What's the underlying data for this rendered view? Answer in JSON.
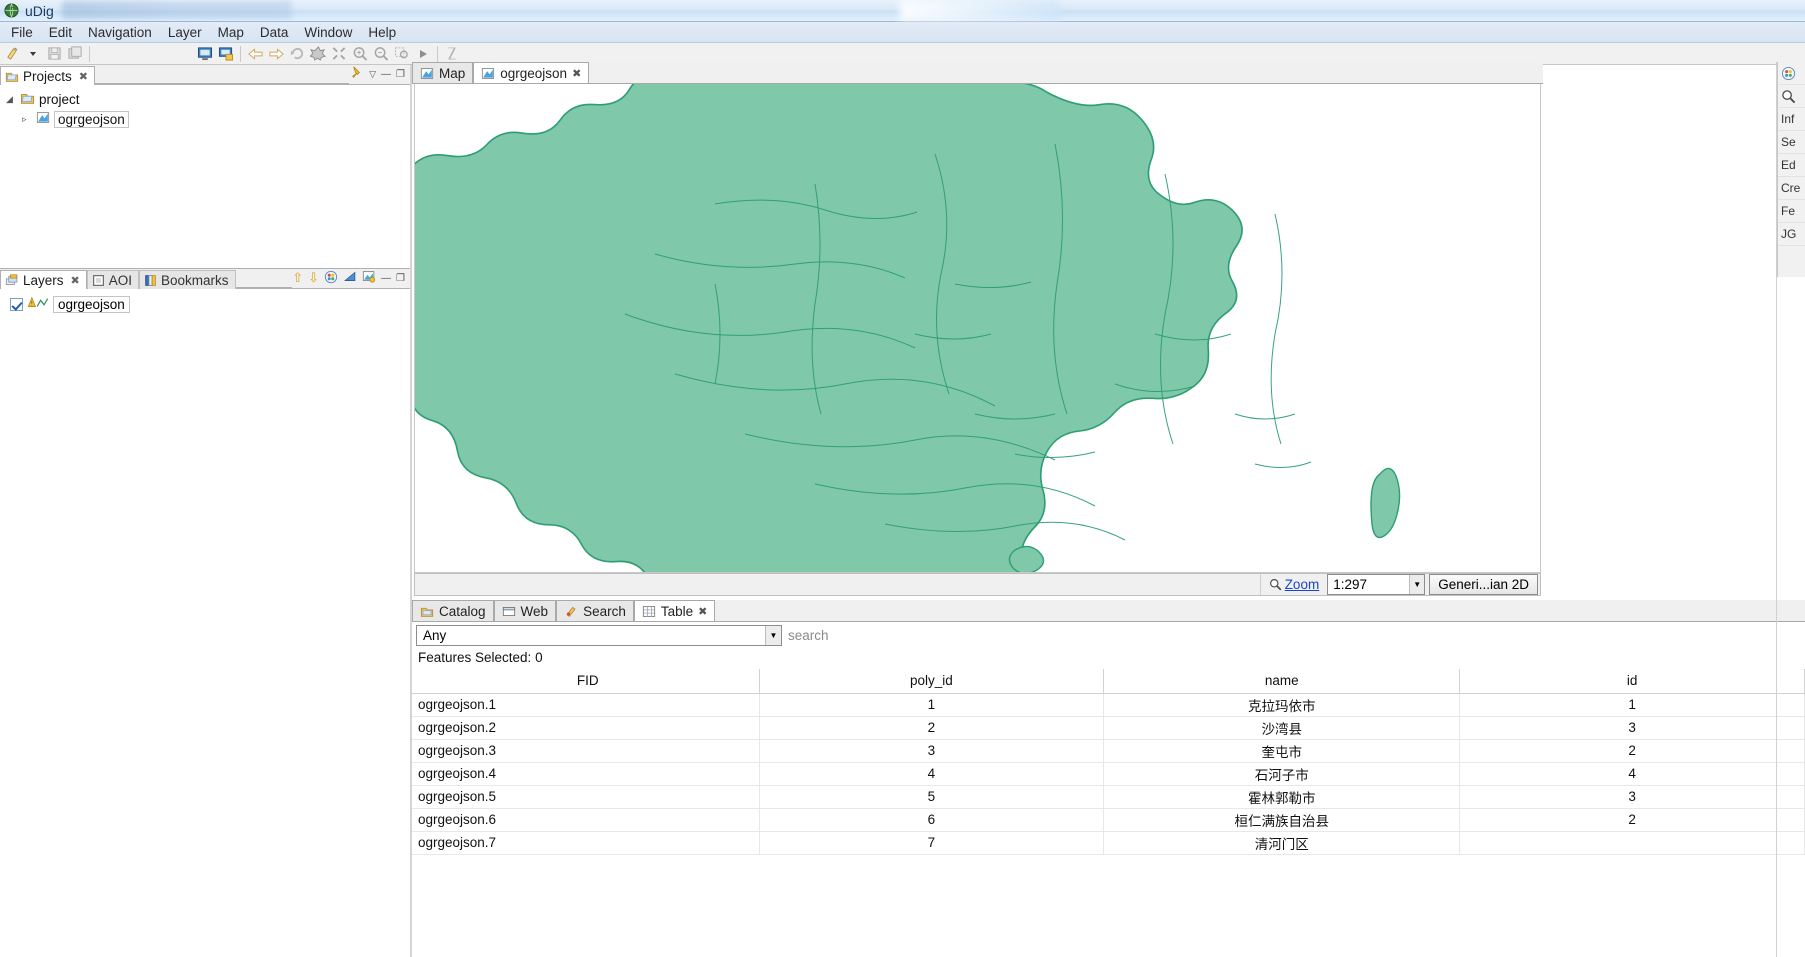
{
  "window": {
    "title": "uDig",
    "app_icon": "globe-icon"
  },
  "menu": {
    "items": [
      "File",
      "Edit",
      "Navigation",
      "Layer",
      "Map",
      "Data",
      "Window",
      "Help"
    ]
  },
  "toolbar": {
    "buttons": [
      {
        "name": "new-icon",
        "glyph": "✧"
      },
      {
        "name": "new-dropdown-icon",
        "glyph": "▾"
      },
      {
        "name": "save-icon",
        "glyph": "Ὃe"
      },
      {
        "name": "save-all-icon",
        "glyph": "⧉"
      },
      {
        "name": "show-map-icon",
        "glyph": "▣"
      },
      {
        "name": "add-layer-icon",
        "glyph": "▤"
      },
      {
        "name": "back-icon",
        "glyph": "⇦"
      },
      {
        "name": "forward-icon",
        "glyph": "⇨"
      },
      {
        "name": "refresh-icon",
        "glyph": "⟳"
      },
      {
        "name": "globe-tool-icon",
        "glyph": "✳"
      },
      {
        "name": "zoom-extent-icon",
        "glyph": "⤢"
      },
      {
        "name": "zoom-in-icon",
        "glyph": "⊕"
      },
      {
        "name": "zoom-out-icon",
        "glyph": "⊖"
      },
      {
        "name": "zoom-selection-icon",
        "glyph": "⬚"
      },
      {
        "name": "play-icon",
        "glyph": "▶"
      },
      {
        "name": "measure-icon",
        "glyph": "╱"
      }
    ]
  },
  "projects_panel": {
    "tab_label": "Projects",
    "tab_icon": "projects-icon",
    "close_glyph": "✖",
    "pin_icon": "pin-icon",
    "menu_glyph": "▽",
    "minimize_glyph": "—",
    "maximize_glyph": "❐",
    "tree": {
      "root": {
        "label": "project",
        "icon": "project-folder-icon",
        "arrow": "◢"
      },
      "child": {
        "label": "ogrgeojson",
        "icon": "map-icon",
        "arrow": "▹"
      }
    }
  },
  "layers_panel": {
    "tabs": [
      {
        "label": "Layers",
        "icon": "layers-icon",
        "active": true,
        "close_glyph": "✖"
      },
      {
        "label": "AOI",
        "icon": "aoi-icon",
        "active": false
      },
      {
        "label": "Bookmarks",
        "icon": "bookmarks-icon",
        "active": false
      }
    ],
    "tools": [
      {
        "name": "move-up-icon",
        "glyph": "⇧"
      },
      {
        "name": "move-down-icon",
        "glyph": "⇩"
      },
      {
        "name": "style-palette-icon",
        "glyph": "◕"
      },
      {
        "name": "opacity-icon",
        "glyph": "◢"
      },
      {
        "name": "layer-properties-icon",
        "glyph": "▧"
      },
      {
        "name": "minimize-icon",
        "glyph": "—"
      },
      {
        "name": "maximize-icon",
        "glyph": "❐"
      }
    ],
    "layer": {
      "name": "ogrgeojson",
      "checked": true,
      "icon": "warning-line-icon"
    }
  },
  "editor": {
    "tabs": [
      {
        "label": "Map",
        "icon": "map-icon",
        "active": false
      },
      {
        "label": "ogrgeojson",
        "icon": "map-icon",
        "active": true,
        "close_glyph": "✖"
      }
    ],
    "statusbar": {
      "zoom_label": "Zoom",
      "zoom_icon": "magnifier-icon",
      "scale_value": "1:297",
      "scale_arrow": "▼",
      "crs_label": "Generi...ian 2D"
    },
    "map": {
      "fill_color": "#7fc8a9",
      "stroke_color": "#2e9e74",
      "background": "#ffffff"
    }
  },
  "bottom_view": {
    "tabs": [
      {
        "label": "Catalog",
        "icon": "catalog-icon",
        "active": false
      },
      {
        "label": "Web",
        "icon": "web-icon",
        "active": false
      },
      {
        "label": "Search",
        "icon": "search-icon",
        "active": false
      },
      {
        "label": "Table",
        "icon": "table-icon",
        "active": true,
        "close_glyph": "✖"
      }
    ],
    "filter": {
      "selected": "Any",
      "arrow": "▼"
    },
    "search": {
      "value": "",
      "placeholder": "search"
    },
    "features_selected": "Features Selected: 0",
    "table": {
      "columns": [
        "FID",
        "poly_id",
        "name",
        "id"
      ],
      "rows": [
        [
          "ogrgeojson.1",
          "1",
          "克拉玛依市",
          "1"
        ],
        [
          "ogrgeojson.2",
          "2",
          "沙湾县",
          "3"
        ],
        [
          "ogrgeojson.3",
          "3",
          "奎屯市",
          "2"
        ],
        [
          "ogrgeojson.4",
          "4",
          "石河子市",
          "4"
        ],
        [
          "ogrgeojson.5",
          "5",
          "霍林郭勒市",
          "3"
        ],
        [
          "ogrgeojson.6",
          "6",
          "桓仁满族自治县",
          "2"
        ],
        [
          "ogrgeojson.7",
          "7",
          "清河门区",
          ""
        ]
      ]
    }
  },
  "right_strip": {
    "items": [
      {
        "name": "palette-icon",
        "label": ""
      },
      {
        "name": "search-icon",
        "label": ""
      },
      {
        "name": "info-tool",
        "label": "Inf"
      },
      {
        "name": "select-tool",
        "label": "Se"
      },
      {
        "name": "edit-tool",
        "label": "Ed"
      },
      {
        "name": "create-tool",
        "label": "Cre"
      },
      {
        "name": "feature-tool",
        "label": "Fe"
      },
      {
        "name": "jgrass-tool",
        "label": "JG"
      }
    ]
  }
}
